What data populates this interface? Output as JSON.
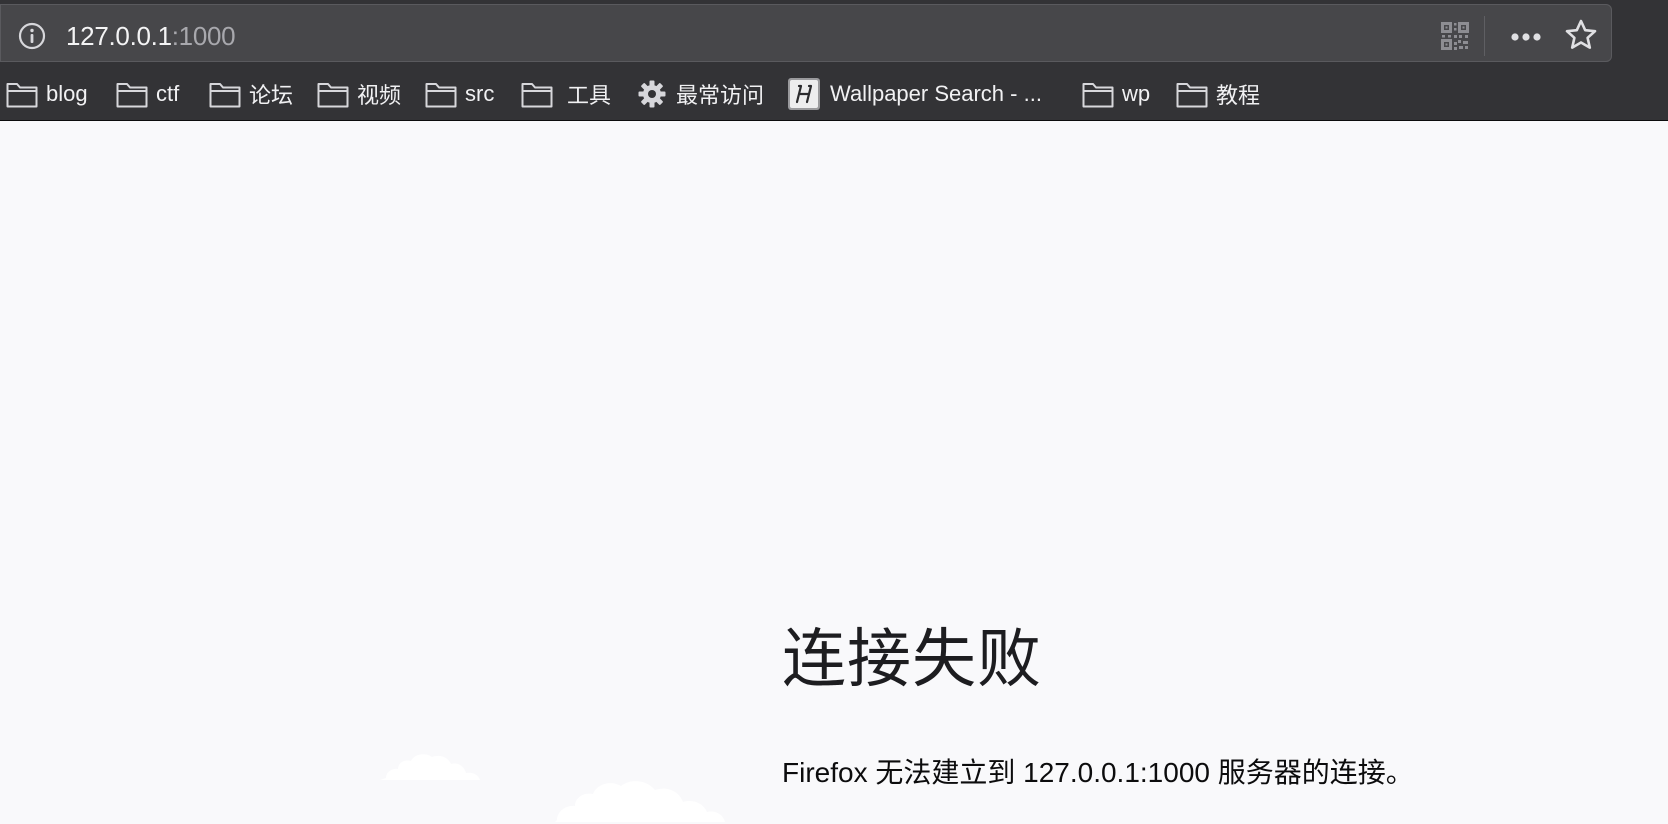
{
  "urlbar": {
    "host": "127.0.0.1",
    "port": ":1000"
  },
  "bookmarks": [
    {
      "label": "blog",
      "icon": "folder-icon"
    },
    {
      "label": "ctf",
      "icon": "folder-icon"
    },
    {
      "label": "论坛",
      "icon": "folder-icon"
    },
    {
      "label": "视频",
      "icon": "folder-icon"
    },
    {
      "label": "src",
      "icon": "folder-icon"
    },
    {
      "label": "工具",
      "icon": "folder-icon"
    },
    {
      "label": "最常访问",
      "icon": "gear-icon"
    },
    {
      "label": "Wallpaper Search - ...",
      "icon": "site-favicon"
    },
    {
      "label": "wp",
      "icon": "folder-icon"
    },
    {
      "label": "教程",
      "icon": "folder-icon"
    }
  ],
  "error": {
    "title": "连接失败",
    "description": "Firefox 无法建立到 127.0.0.1:1000 服务器的连接。"
  },
  "colors": {
    "toolbar_bg": "#333336",
    "urlbar_bg": "#47474a",
    "page_bg": "#f9f9fb"
  }
}
